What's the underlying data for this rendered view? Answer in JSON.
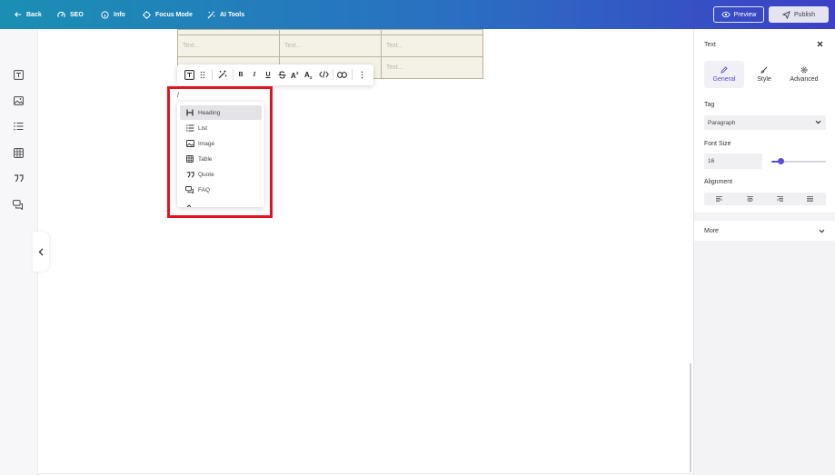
{
  "topbar": {
    "back_label": "Back",
    "seo_label": "SEO",
    "info_label": "Info",
    "focus_label": "Focus Mode",
    "ai_label": "AI Tools",
    "preview_label": "Preview",
    "publish_label": "Publish"
  },
  "table": {
    "cells": [
      [
        "Text...",
        "Text...",
        "Text..."
      ],
      [
        "Text...",
        "Text...",
        "Text..."
      ]
    ]
  },
  "slash": {
    "input_text": "/",
    "items": [
      {
        "label": "Heading",
        "icon": "heading-icon"
      },
      {
        "label": "List",
        "icon": "list-icon"
      },
      {
        "label": "Image",
        "icon": "image-icon"
      },
      {
        "label": "Table",
        "icon": "table-icon"
      },
      {
        "label": "Quote",
        "icon": "quote-icon"
      },
      {
        "label": "FAQ",
        "icon": "faq-icon"
      }
    ]
  },
  "panel": {
    "title": "Text",
    "tabs": [
      "General",
      "Style",
      "Advanced"
    ],
    "tag_label": "Tag",
    "tag_value": "Paragraph",
    "fontsize_label": "Font Size",
    "fontsize_value": "16",
    "fontsize_slider_fraction": 0.16,
    "alignment_label": "Alignment",
    "more_label": "More"
  },
  "colors": {
    "accent": "#5b4bd8",
    "highlight": "#e0141e",
    "topbar_start": "#1a8fb3",
    "topbar_end": "#3d3fc6"
  }
}
